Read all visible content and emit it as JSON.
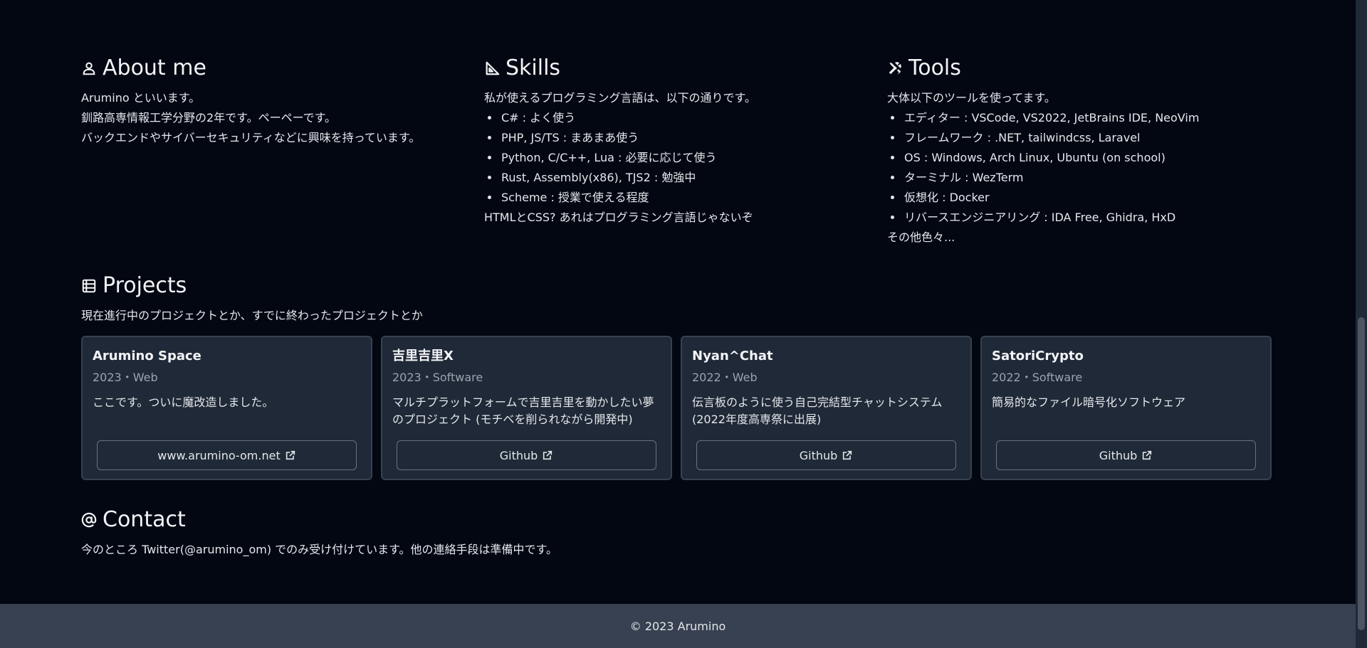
{
  "about": {
    "title": "About me",
    "lines": [
      "Arumino といいます。",
      "釧路高専情報工学分野の2年です。ペーペーです。",
      "バックエンドやサイバーセキュリティなどに興味を持っています。"
    ]
  },
  "skills": {
    "title": "Skills",
    "intro": "私が使えるプログラミング言語は、以下の通りです。",
    "items": [
      "C# : よく使う",
      "PHP, JS/TS : まあまあ使う",
      "Python, C/C++, Lua : 必要に応じて使う",
      "Rust, Assembly(x86), TJS2 : 勉強中",
      "Scheme : 授業で使える程度"
    ],
    "outro": "HTMLとCSS? あれはプログラミング言語じゃないぞ"
  },
  "tools": {
    "title": "Tools",
    "intro": "大体以下のツールを使ってます。",
    "items": [
      "エディター : VSCode, VS2022, JetBrains IDE, NeoVim",
      "フレームワーク : .NET, tailwindcss, Laravel",
      "OS : Windows, Arch Linux, Ubuntu (on school)",
      "ターミナル : WezTerm",
      "仮想化 : Docker",
      "リバースエンジニアリング : IDA Free, Ghidra, HxD"
    ],
    "outro": "その他色々..."
  },
  "projects": {
    "title": "Projects",
    "subtitle": "現在進行中のプロジェクトとか、すでに終わったプロジェクトとか",
    "cards": [
      {
        "title": "Arumino Space",
        "meta": "2023・Web",
        "desc": "ここです。ついに魔改造しました。",
        "link": "www.arumino-om.net"
      },
      {
        "title": "吉里吉里X",
        "meta": "2023・Software",
        "desc": "マルチプラットフォームで吉里吉里を動かしたい夢のプロジェクト (モチベを削られながら開発中)",
        "link": "Github"
      },
      {
        "title": "Nyan^Chat",
        "meta": "2022・Web",
        "desc": "伝言板のように使う自己完結型チャットシステム (2022年度高専祭に出展)",
        "link": "Github"
      },
      {
        "title": "SatoriCrypto",
        "meta": "2022・Software",
        "desc": "簡易的なファイル暗号化ソフトウェア",
        "link": "Github"
      }
    ]
  },
  "contact": {
    "title": "Contact",
    "text": "今のところ Twitter(@arumino_om) でのみ受け付けています。他の連絡手段は準備中です。"
  },
  "footer": {
    "text": "© 2023 Arumino"
  },
  "icons": {
    "about": "user-icon",
    "skills": "ruler-triangle-icon",
    "tools": "tools-icon",
    "projects": "list-icon",
    "contact": "at-icon",
    "external": "external-link-icon"
  }
}
